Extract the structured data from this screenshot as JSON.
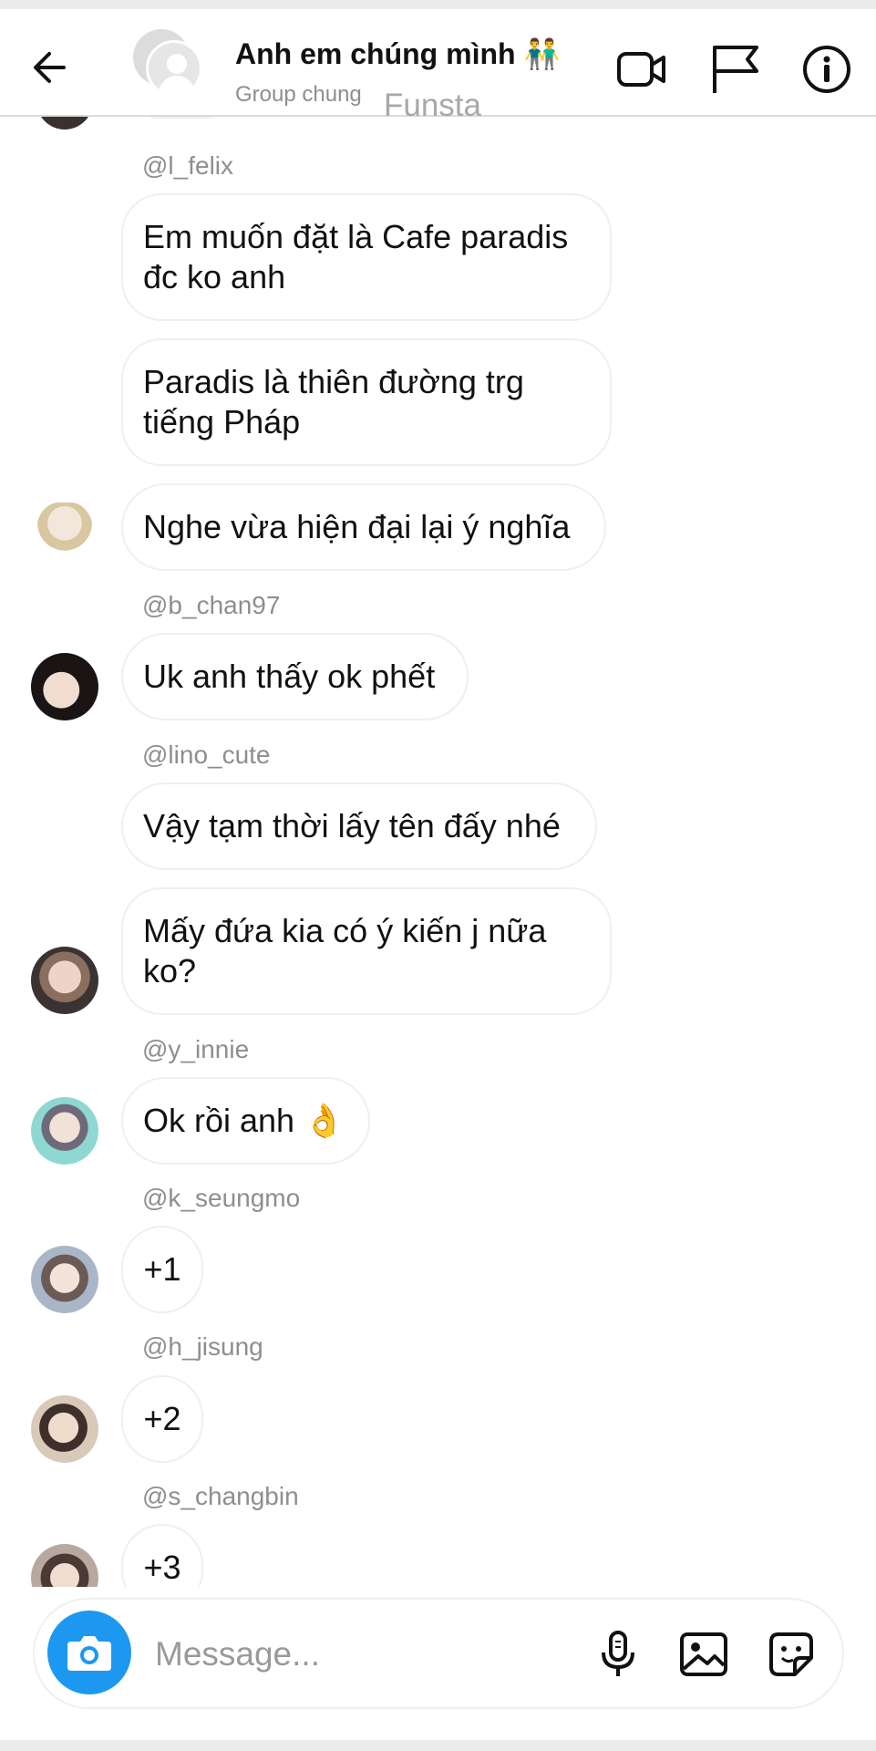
{
  "header": {
    "title": "Anh em chúng mình 👬",
    "subtitle": "Group chung",
    "watermark": "Funsta"
  },
  "messages": [
    {
      "username": "@l_felix",
      "bubbles": [
        "Em muốn đặt là Cafe paradis đc ko anh",
        "Paradis là thiên đường trg tiếng Pháp",
        "Nghe vừa hiện đại lại ý nghĩa"
      ]
    },
    {
      "username": "@b_chan97",
      "bubbles": [
        "Uk anh thấy ok phết"
      ]
    },
    {
      "username": "@lino_cute",
      "bubbles": [
        "Vậy tạm thời lấy tên đấy nhé",
        "Mấy đứa kia có ý kiến j nữa ko?"
      ]
    },
    {
      "username": "@y_innie",
      "bubbles": [
        "Ok rồi anh 👌"
      ]
    },
    {
      "username": "@k_seungmo",
      "bubbles": [
        "+1"
      ]
    },
    {
      "username": "@h_jisung",
      "bubbles": [
        "+2"
      ]
    },
    {
      "username": "@s_changbin",
      "bubbles": [
        "+3"
      ]
    }
  ],
  "composer": {
    "placeholder": "Message..."
  },
  "icons": {
    "back": "arrow-left-icon",
    "video": "video-camera-icon",
    "flag": "flag-icon",
    "info": "info-icon",
    "camera": "camera-icon",
    "mic": "microphone-icon",
    "gallery": "image-icon",
    "sticker": "sticker-icon"
  },
  "colors": {
    "accent": "#1d98f0",
    "bubble_border": "#efefef",
    "muted_text": "#8e8e8e"
  }
}
